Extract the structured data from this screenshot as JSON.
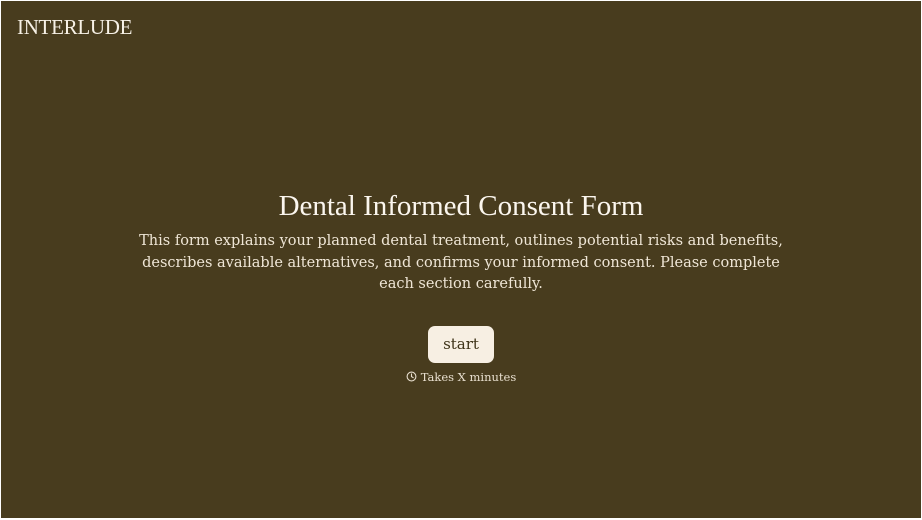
{
  "brand": {
    "name": "INTERLUDE"
  },
  "form": {
    "title": "Dental Informed Consent Form",
    "description": "This form explains your planned dental treatment, outlines potential risks and benefits, describes available alternatives, and confirms your informed consent. Please complete each section carefully.",
    "start_label": "start",
    "duration_text": "Takes X minutes",
    "duration_icon": "clock-icon"
  },
  "colors": {
    "background": "#483c1e",
    "text": "#f5eee2",
    "button_bg": "#f7efe3",
    "button_text": "#3e3318"
  }
}
